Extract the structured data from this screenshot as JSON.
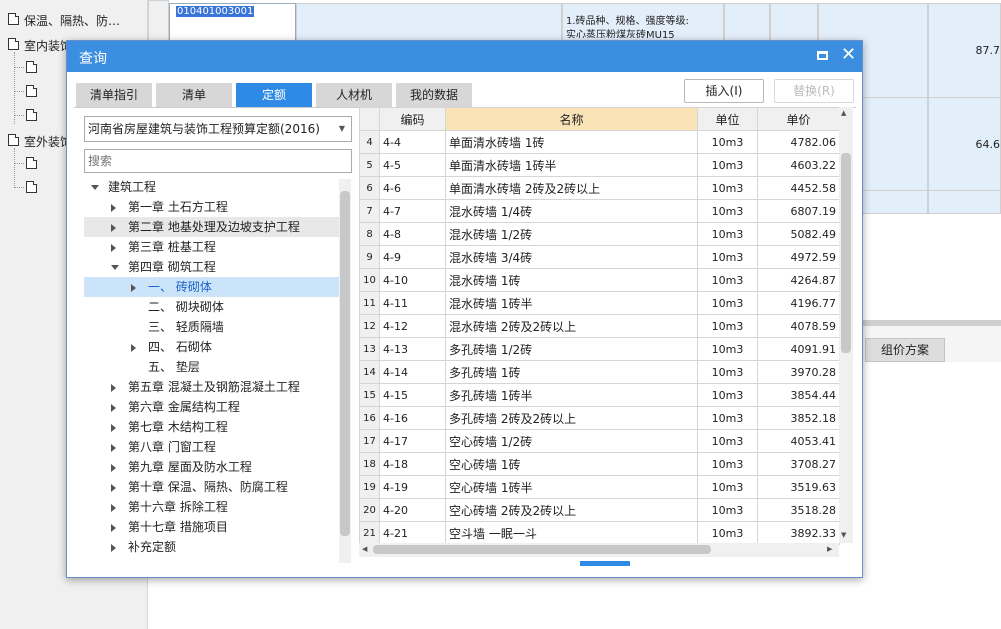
{
  "left_panel": {
    "items": [
      {
        "label": "保温、隔热、防…",
        "type": "doc"
      },
      {
        "label": "室内装饰",
        "type": "doc"
      },
      {
        "label": "",
        "type": "doc"
      },
      {
        "label": "",
        "type": "doc"
      },
      {
        "label": "",
        "type": "doc"
      },
      {
        "label": "室外装饰",
        "type": "doc"
      },
      {
        "label": "",
        "type": "doc"
      },
      {
        "label": "",
        "type": "doc"
      }
    ]
  },
  "background": {
    "code_cell": "010401003001",
    "desc_line1": "1.砖品种、规格、强度等级:",
    "desc_line2": "实心蒸压粉煤灰砖MU15",
    "value1": "87.7",
    "value2": "64.6",
    "tab_label": "组价方案"
  },
  "dialog": {
    "title": "查询",
    "tabs": [
      {
        "label": "清单指引",
        "active": false
      },
      {
        "label": "清单",
        "active": false
      },
      {
        "label": "定额",
        "active": true
      },
      {
        "label": "人材机",
        "active": false
      },
      {
        "label": "我的数据",
        "active": false
      }
    ],
    "insert_button": "插入(I)",
    "replace_button": "替换(R)",
    "quota_select": "河南省房屋建筑与装饰工程预算定额(2016)",
    "search_placeholder": "搜索",
    "tree": [
      {
        "label": "建筑工程",
        "level": 0,
        "arrow": "down"
      },
      {
        "label": "第一章 土石方工程",
        "level": 1,
        "arrow": "right"
      },
      {
        "label": "第二章 地基处理及边坡支护工程",
        "level": 1,
        "arrow": "right",
        "hover": true
      },
      {
        "label": "第三章 桩基工程",
        "level": 1,
        "arrow": "right"
      },
      {
        "label": "第四章 砌筑工程",
        "level": 1,
        "arrow": "down"
      },
      {
        "label": "一、 砖砌体",
        "level": 2,
        "arrow": "right",
        "selected": true
      },
      {
        "label": "二、 砌块砌体",
        "level": 2,
        "arrow": ""
      },
      {
        "label": "三、 轻质隔墙",
        "level": 2,
        "arrow": ""
      },
      {
        "label": "四、 石砌体",
        "level": 2,
        "arrow": "right"
      },
      {
        "label": "五、 垫层",
        "level": 2,
        "arrow": ""
      },
      {
        "label": "第五章 混凝土及钢筋混凝土工程",
        "level": 1,
        "arrow": "right"
      },
      {
        "label": "第六章 金属结构工程",
        "level": 1,
        "arrow": "right"
      },
      {
        "label": "第七章 木结构工程",
        "level": 1,
        "arrow": "right"
      },
      {
        "label": "第八章 门窗工程",
        "level": 1,
        "arrow": "right"
      },
      {
        "label": "第九章 屋面及防水工程",
        "level": 1,
        "arrow": "right"
      },
      {
        "label": "第十章 保温、隔热、防腐工程",
        "level": 1,
        "arrow": "right"
      },
      {
        "label": "第十六章 拆除工程",
        "level": 1,
        "arrow": "right"
      },
      {
        "label": "第十七章 措施项目",
        "level": 1,
        "arrow": "right"
      },
      {
        "label": "补充定额",
        "level": 1,
        "arrow": "right"
      }
    ],
    "columns": [
      "编码",
      "名称",
      "单位",
      "单价"
    ],
    "rows": [
      {
        "n": "4",
        "code": "4-4",
        "name": "单面清水砖墙 1砖",
        "unit": "10m3",
        "price": "4782.06"
      },
      {
        "n": "5",
        "code": "4-5",
        "name": "单面清水砖墙 1砖半",
        "unit": "10m3",
        "price": "4603.22"
      },
      {
        "n": "6",
        "code": "4-6",
        "name": "单面清水砖墙 2砖及2砖以上",
        "unit": "10m3",
        "price": "4452.58"
      },
      {
        "n": "7",
        "code": "4-7",
        "name": "混水砖墙 1/4砖",
        "unit": "10m3",
        "price": "6807.19"
      },
      {
        "n": "8",
        "code": "4-8",
        "name": "混水砖墙 1/2砖",
        "unit": "10m3",
        "price": "5082.49"
      },
      {
        "n": "9",
        "code": "4-9",
        "name": "混水砖墙 3/4砖",
        "unit": "10m3",
        "price": "4972.59"
      },
      {
        "n": "10",
        "code": "4-10",
        "name": "混水砖墙 1砖",
        "unit": "10m3",
        "price": "4264.87"
      },
      {
        "n": "11",
        "code": "4-11",
        "name": "混水砖墙 1砖半",
        "unit": "10m3",
        "price": "4196.77"
      },
      {
        "n": "12",
        "code": "4-12",
        "name": "混水砖墙 2砖及2砖以上",
        "unit": "10m3",
        "price": "4078.59"
      },
      {
        "n": "13",
        "code": "4-13",
        "name": "多孔砖墙 1/2砖",
        "unit": "10m3",
        "price": "4091.91"
      },
      {
        "n": "14",
        "code": "4-14",
        "name": "多孔砖墙 1砖",
        "unit": "10m3",
        "price": "3970.28"
      },
      {
        "n": "15",
        "code": "4-15",
        "name": "多孔砖墙 1砖半",
        "unit": "10m3",
        "price": "3854.44"
      },
      {
        "n": "16",
        "code": "4-16",
        "name": "多孔砖墙 2砖及2砖以上",
        "unit": "10m3",
        "price": "3852.18"
      },
      {
        "n": "17",
        "code": "4-17",
        "name": "空心砖墙 1/2砖",
        "unit": "10m3",
        "price": "4053.41"
      },
      {
        "n": "18",
        "code": "4-18",
        "name": "空心砖墙 1砖",
        "unit": "10m3",
        "price": "3708.27"
      },
      {
        "n": "19",
        "code": "4-19",
        "name": "空心砖墙 1砖半",
        "unit": "10m3",
        "price": "3519.63"
      },
      {
        "n": "20",
        "code": "4-20",
        "name": "空心砖墙 2砖及2砖以上",
        "unit": "10m3",
        "price": "3518.28"
      },
      {
        "n": "21",
        "code": "4-21",
        "name": "空斗墙 一眠一斗",
        "unit": "10m3",
        "price": "3892.33"
      }
    ]
  }
}
